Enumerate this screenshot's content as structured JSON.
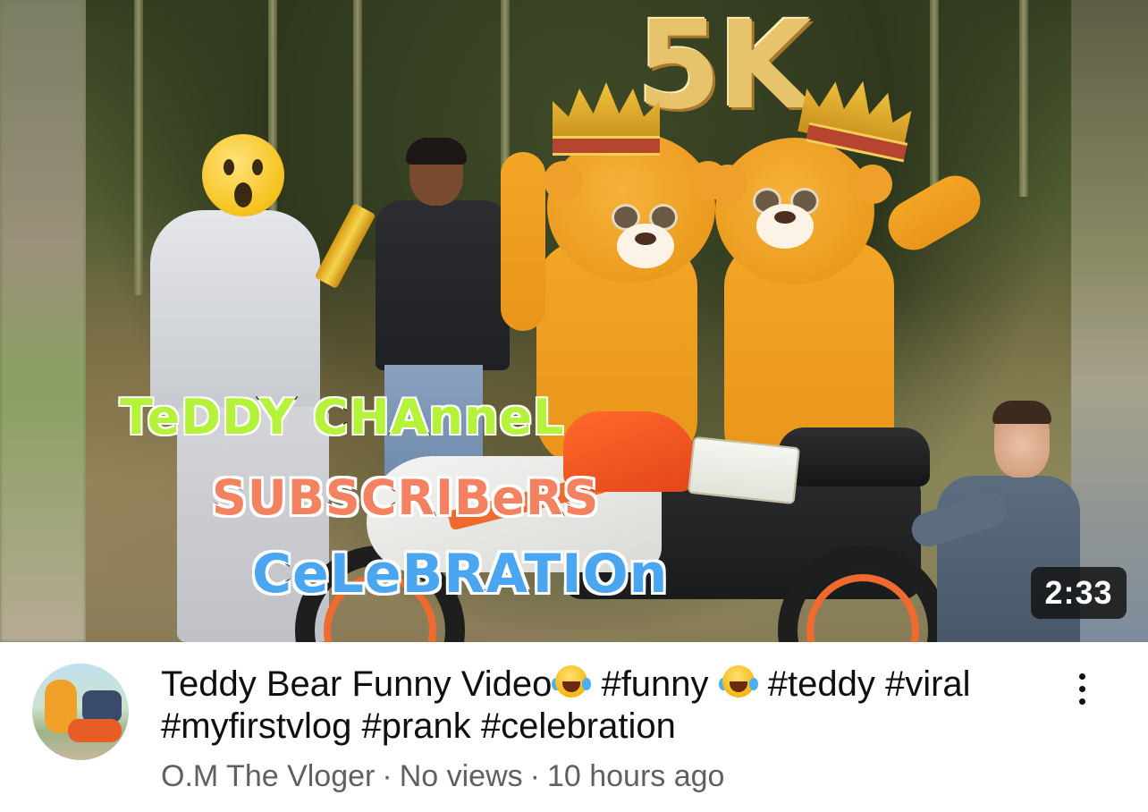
{
  "video": {
    "duration": "2:33",
    "thumbnail_overlay": {
      "balloon_text": "5K",
      "line1": "TeDDY CHAnneL",
      "line2": "SUBSCRIBeRS",
      "line3": "CeLeBRATIOn"
    },
    "title": {
      "part1": "Teddy Bear Funny Video",
      "part2": " #funny ",
      "part3": " #teddy #viral #myfirstvlog #prank #celebration"
    },
    "emoji": "face-with-tears-of-joy-icon"
  },
  "channel": {
    "name": "O.M The Vloger",
    "avatar_icon": "channel-avatar"
  },
  "meta": {
    "views": "No views",
    "age": "10 hours ago",
    "separator": "·"
  },
  "colors": {
    "title_text": "#0f0f0f",
    "meta_text": "#606060",
    "badge_bg": "#141414",
    "caption_green": "#b5f23a",
    "caption_orange": "#f4815f",
    "caption_blue": "#4aa6f0"
  },
  "menu": {
    "icon": "more-vertical-icon"
  }
}
